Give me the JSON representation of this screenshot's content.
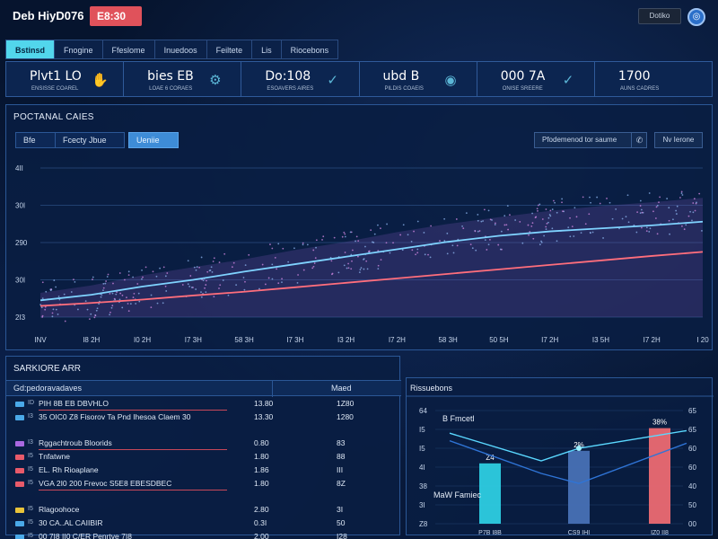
{
  "header": {
    "title": "Deb HiyD076",
    "badge": "E8:30",
    "button_label": "Dotiko"
  },
  "tabs": [
    {
      "label": "Bstinsd",
      "active": true
    },
    {
      "label": "Fnogine",
      "active": false
    },
    {
      "label": "Ffeslome",
      "active": false
    },
    {
      "label": "Inuedoos",
      "active": false
    },
    {
      "label": "Feiltete",
      "active": false
    },
    {
      "label": "Lis",
      "active": false
    },
    {
      "label": "Riocebons",
      "active": false
    }
  ],
  "stats": [
    {
      "value": "Plvt1 LO",
      "caption": "ENSISSE COAREL",
      "icon": "hand-icon"
    },
    {
      "value": "bies EB",
      "caption": "LOAE 6 CORAES",
      "icon": "gear-icon"
    },
    {
      "value": "Do:108",
      "caption": "ESOAVERS AIRES",
      "icon": "check-icon"
    },
    {
      "value": "ubd B",
      "caption": "PILDIS COAEIS",
      "icon": "target-icon"
    },
    {
      "value": "000 7A",
      "caption": "ONISE SREERE",
      "icon": "check-icon"
    },
    {
      "value": "1700",
      "caption": "AUNS CADRES",
      "icon": "none"
    }
  ],
  "chart_panel": {
    "title": "POCTANAL CAIES",
    "filters": [
      {
        "label": "Bfe",
        "active": false
      },
      {
        "label": "Fcecty Jbue",
        "active": false
      },
      {
        "label": "Ueniie",
        "active": true
      }
    ],
    "search_placeholder": "Pfodemenod tor saume",
    "search_icon": "phone-icon",
    "side_button": "Nv Ierone"
  },
  "chart_data": {
    "type": "line",
    "x": [
      "INV",
      "I8 2H",
      "I0 2H",
      "I7 3H",
      "58 3H",
      "I7 3H",
      "I3 2H",
      "I7 2H",
      "58 3H",
      "50 5H",
      "I7 2H",
      "I3 5H",
      "I7 2H",
      "I 20"
    ],
    "y_ticks": [
      "2I3",
      "30I",
      "290",
      "30I",
      "4II"
    ],
    "ylim": [
      0,
      4
    ],
    "grid": true,
    "series": [
      {
        "color": "#7fd3ff",
        "values": [
          0.45,
          0.6,
          0.82,
          1.0,
          1.22,
          1.42,
          1.62,
          1.82,
          2.02,
          2.18,
          2.3,
          2.38,
          2.46,
          2.56
        ]
      },
      {
        "color": "#ff6e7c",
        "values": [
          0.3,
          0.38,
          0.47,
          0.58,
          0.68,
          0.8,
          0.92,
          1.04,
          1.16,
          1.28,
          1.4,
          1.52,
          1.64,
          1.75
        ]
      },
      {
        "color": "#c98be8",
        "values": [
          0.65,
          0.85,
          1.12,
          1.34,
          1.55,
          1.8,
          2.02,
          2.28,
          2.5,
          2.68,
          2.85,
          2.98,
          3.08,
          3.2
        ]
      }
    ]
  },
  "table_panel": {
    "title": "SARKIORE ARR",
    "col_name": "Gd:pedoravadaves",
    "col_value": "Maed",
    "rows": [
      {
        "marker": "#4aa9e8",
        "id": "ID",
        "label": "PIH 8B EB DBVHLO",
        "num": "13.80",
        "val": "1Z80"
      },
      {
        "marker": "#4aa9e8",
        "id": "I3",
        "label": "35 OIC0 Z8 Fisorov Ta Pnd Ihesoa Claem 30",
        "num": "13.30",
        "val": "1280"
      },
      {
        "marker": "#a968e0",
        "id": "I3",
        "label": "Rggachtroub Bloorids",
        "num": "0.80",
        "val": "83"
      },
      {
        "marker": "#e85a6a",
        "id": "I5",
        "label": "Tnfatwne",
        "num": "1.80",
        "val": "88"
      },
      {
        "marker": "#e85a6a",
        "id": "I5",
        "label": "EL. Rh Rioaplane",
        "num": "1.86",
        "val": "III"
      },
      {
        "marker": "#e85a6a",
        "id": "I5",
        "label": "VGA 2I0 200 Frevoc S5E8 EBESDBEC",
        "num": "1.80",
        "val": "8Z"
      },
      {
        "marker": "#e8c33a",
        "id": "I5",
        "label": "Rlagoohoce",
        "num": "2.80",
        "val": "3I"
      },
      {
        "marker": "#4aa9e8",
        "id": "I5",
        "label": "30 CA..AL CAIIBIR",
        "num": "0.3I",
        "val": "50"
      },
      {
        "marker": "#4aa9e8",
        "id": "I5",
        "label": "00 7I8 II0 C/ER Penrtve 7I8",
        "num": "2.00",
        "val": "I28"
      }
    ]
  },
  "bar_panel": {
    "title": "Rissuebons",
    "inner_label_top": "B Fmcetl",
    "inner_label_mid": "MaW Famiec",
    "y_ticks_left": [
      "Z8",
      "3I",
      "38",
      "4I",
      "I5",
      "I5",
      "64"
    ],
    "y_ticks_right": [
      "00",
      "50",
      "40",
      "60",
      "60",
      "65",
      "65"
    ]
  },
  "bar_chart_data": {
    "type": "bar",
    "categories": [
      "P7B I8B",
      "CS9 IHI",
      "IZ0 II8"
    ],
    "values": [
      24,
      29,
      38
    ],
    "value_labels": [
      "Z4",
      "2%",
      "38%"
    ],
    "colors": [
      "#2fd3e6",
      "#4a73b8",
      "#f36d73"
    ],
    "ylim": [
      0,
      45
    ],
    "line_values": [
      36,
      25,
      30,
      37
    ],
    "line2_values": [
      33,
      20,
      16,
      32
    ]
  }
}
